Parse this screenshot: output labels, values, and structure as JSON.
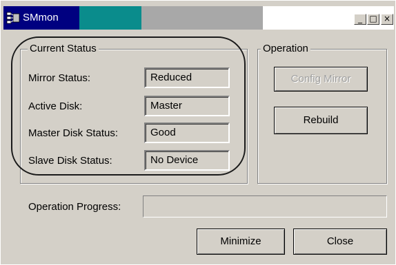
{
  "window": {
    "title": "SMmon",
    "icons": {
      "app": "app-window-icon",
      "minimize": "minimize-icon",
      "maximize": "maximize-icon",
      "close": "close-icon"
    },
    "controls": {
      "minimize_glyph": "_",
      "maximize_glyph": "□",
      "close_glyph": "×"
    }
  },
  "current_status": {
    "title": "Current Status",
    "rows": [
      {
        "label": "Mirror Status:",
        "value": "Reduced"
      },
      {
        "label": "Active Disk:",
        "value": "Master"
      },
      {
        "label": "Master Disk Status:",
        "value": "Good"
      },
      {
        "label": "Slave Disk Status:",
        "value": "No Device"
      }
    ]
  },
  "operation": {
    "title": "Operation",
    "config_mirror_label": "Config Mirror",
    "config_mirror_enabled": false,
    "rebuild_label": "Rebuild"
  },
  "progress": {
    "label": "Operation Progress:",
    "value": 0
  },
  "footer": {
    "minimize_label": "Minimize",
    "close_label": "Close"
  },
  "colors": {
    "face": "#d4d0c8",
    "title_dark": "#000080",
    "title_teal": "#0a8c8c",
    "title_grey": "#a8a8a8"
  }
}
